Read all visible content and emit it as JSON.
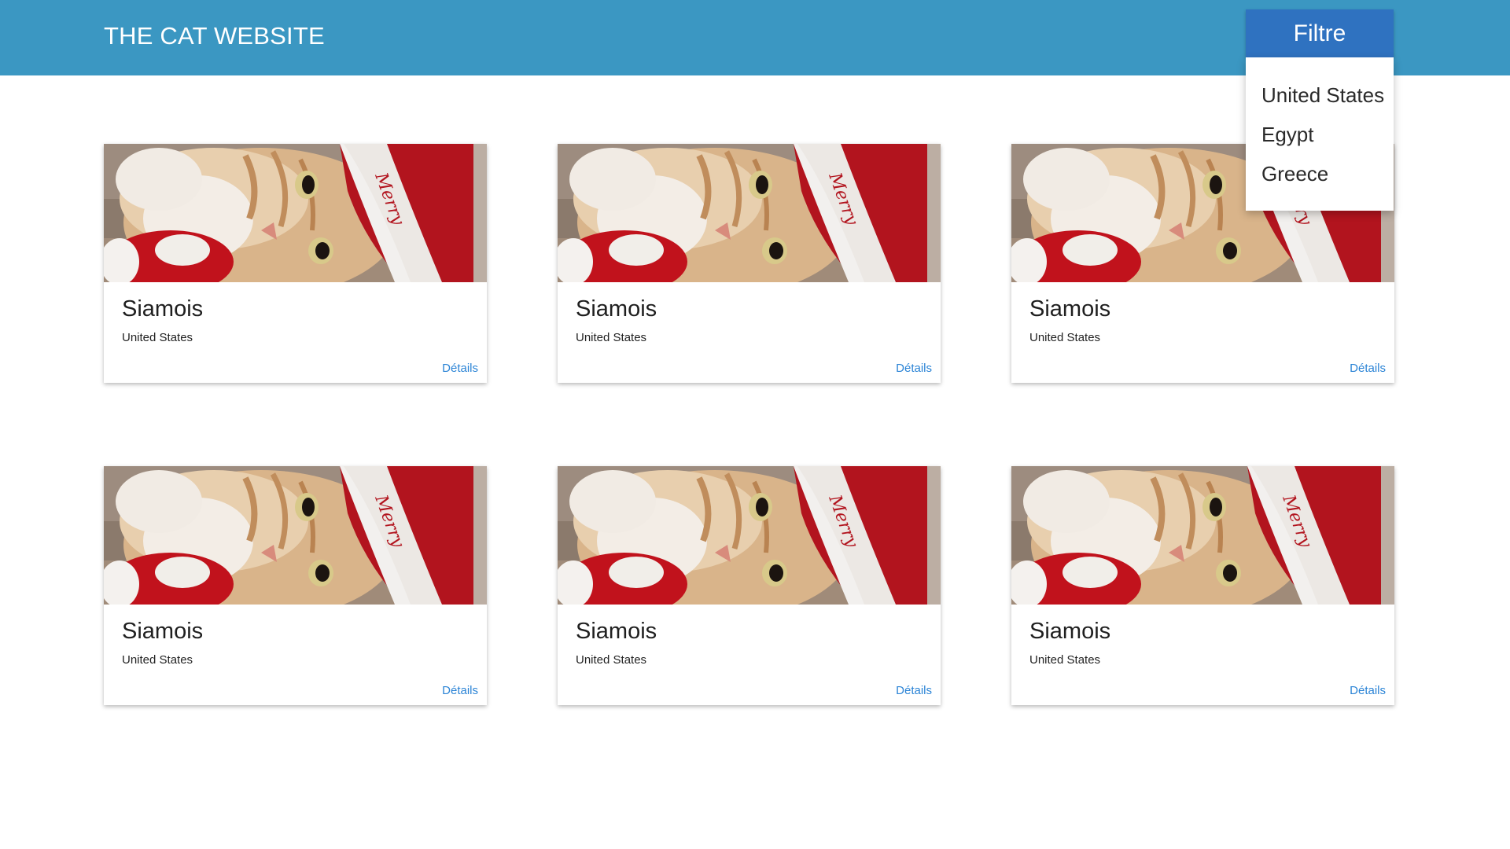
{
  "header": {
    "title": "THE CAT WEBSITE",
    "filter_label": "Filtre"
  },
  "filter_menu": {
    "options": [
      "United States",
      "Egypt",
      "Greece"
    ]
  },
  "cards": [
    {
      "title": "Siamois",
      "country": "United States",
      "details_label": "Détails"
    },
    {
      "title": "Siamois",
      "country": "United States",
      "details_label": "Détails"
    },
    {
      "title": "Siamois",
      "country": "United States",
      "details_label": "Détails"
    },
    {
      "title": "Siamois",
      "country": "United States",
      "details_label": "Détails"
    },
    {
      "title": "Siamois",
      "country": "United States",
      "details_label": "Détails"
    },
    {
      "title": "Siamois",
      "country": "United States",
      "details_label": "Détails"
    }
  ],
  "colors": {
    "header_bg": "#3b97c2",
    "filter_button_bg": "#2f72c0",
    "link": "#2b84d6"
  }
}
